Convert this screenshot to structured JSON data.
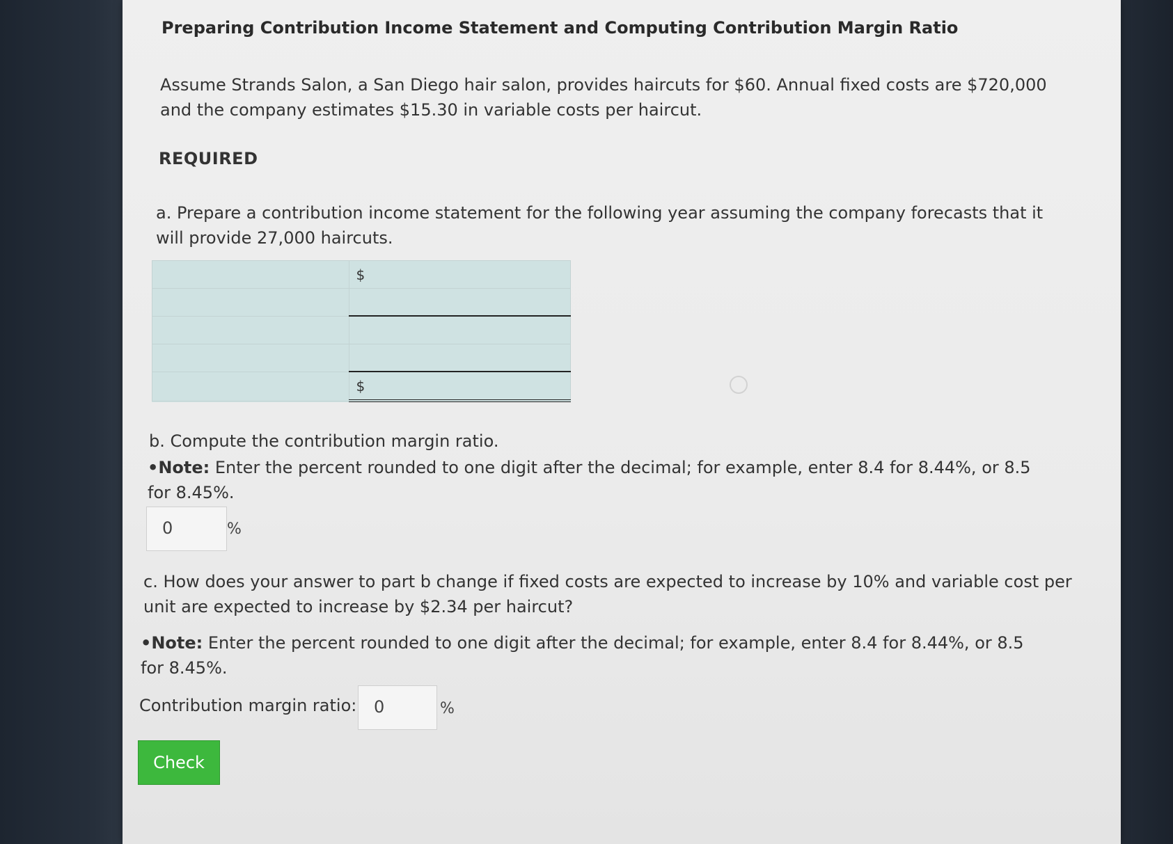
{
  "title": "Preparing Contribution Income Statement and Computing Contribution Margin Ratio",
  "intro": "Assume Strands Salon, a San Diego hair salon, provides haircuts for $60. Annual fixed costs are $720,000 and the company estimates $15.30 in variable costs per haircut.",
  "required_heading": "REQUIRED",
  "part_a": {
    "text": "a. Prepare a contribution income statement for the following year assuming the company forecasts that it will provide 27,000 haircuts.",
    "rows": [
      {
        "label": "",
        "prefix": "$",
        "amount": ""
      },
      {
        "label": "",
        "prefix": "",
        "amount": ""
      },
      {
        "label": "",
        "prefix": "",
        "amount": ""
      },
      {
        "label": "",
        "prefix": "",
        "amount": ""
      },
      {
        "label": "",
        "prefix": "$",
        "amount": ""
      }
    ]
  },
  "part_b": {
    "text": "b. Compute the contribution margin ratio.",
    "note_bold": "•Note:",
    "note_text": " Enter the percent rounded to one digit after the decimal; for example, enter 8.4 for 8.44%, or 8.5 for 8.45%.",
    "value": "0",
    "unit": "%"
  },
  "part_c": {
    "text": "c. How does your answer to part b change if fixed costs are expected to increase by 10% and variable cost per unit are expected to increase by $2.34 per haircut?",
    "note_bold": "•Note:",
    "note_text": " Enter the percent rounded to one digit after the decimal; for example, enter 8.4 for 8.44%, or 8.5 for 8.45%.",
    "label": "Contribution margin ratio:",
    "value": "0",
    "unit": "%"
  },
  "check_label": "Check"
}
